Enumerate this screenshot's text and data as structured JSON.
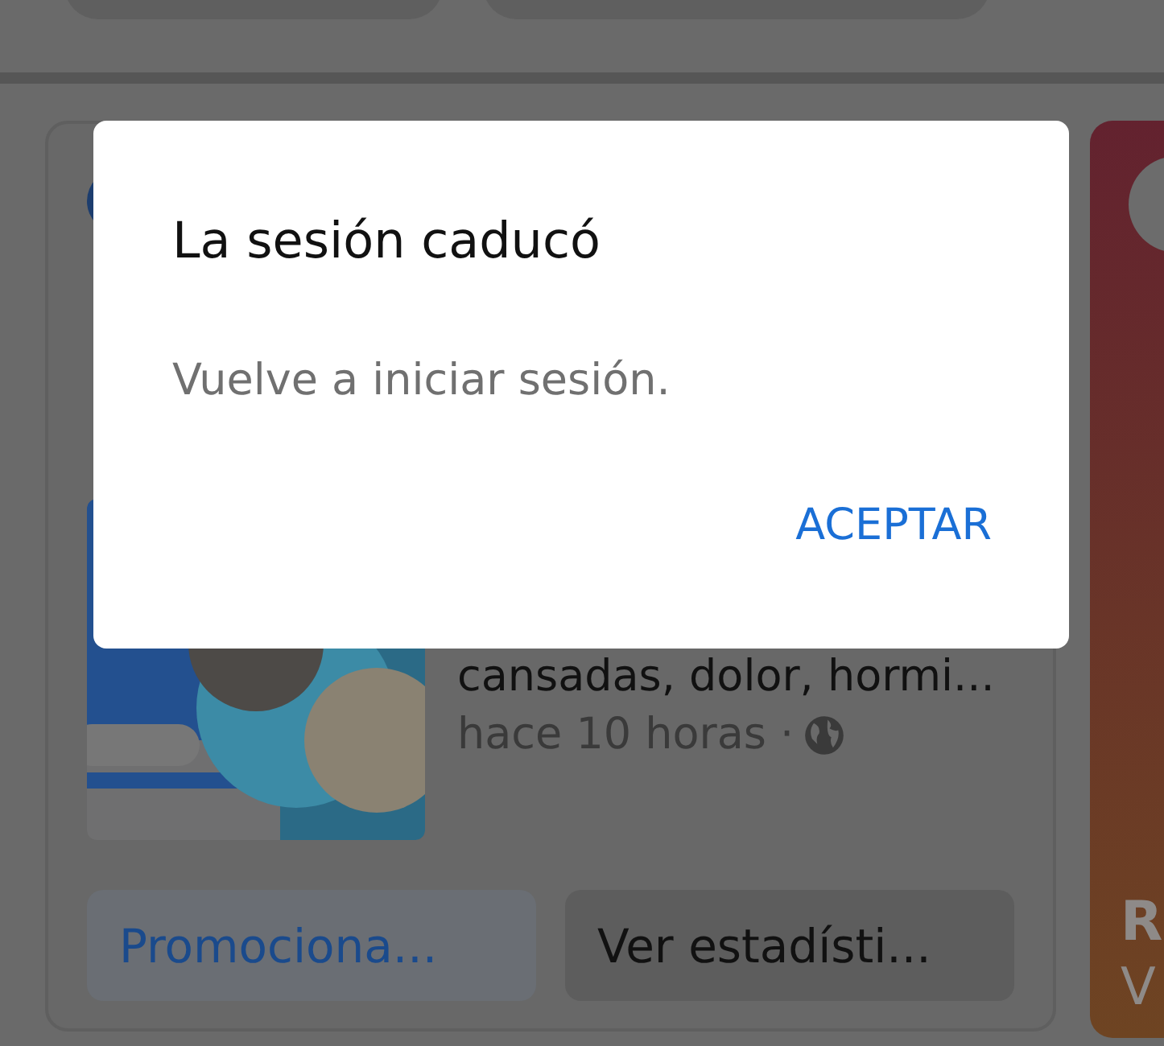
{
  "post_card": {
    "description": "cansadas, dolor, hormi...",
    "meta": "hace 10 horas ·",
    "actions": [
      {
        "label": "Promociona...",
        "kind": "primary"
      },
      {
        "label": "Ver estadísti...",
        "kind": "secondary"
      }
    ]
  },
  "next_card": {
    "title": "R",
    "subtitle": "V"
  },
  "dialog": {
    "title": "La sesión caducó",
    "message": "Vuelve a iniciar sesión.",
    "button": "ACEPTAR"
  }
}
